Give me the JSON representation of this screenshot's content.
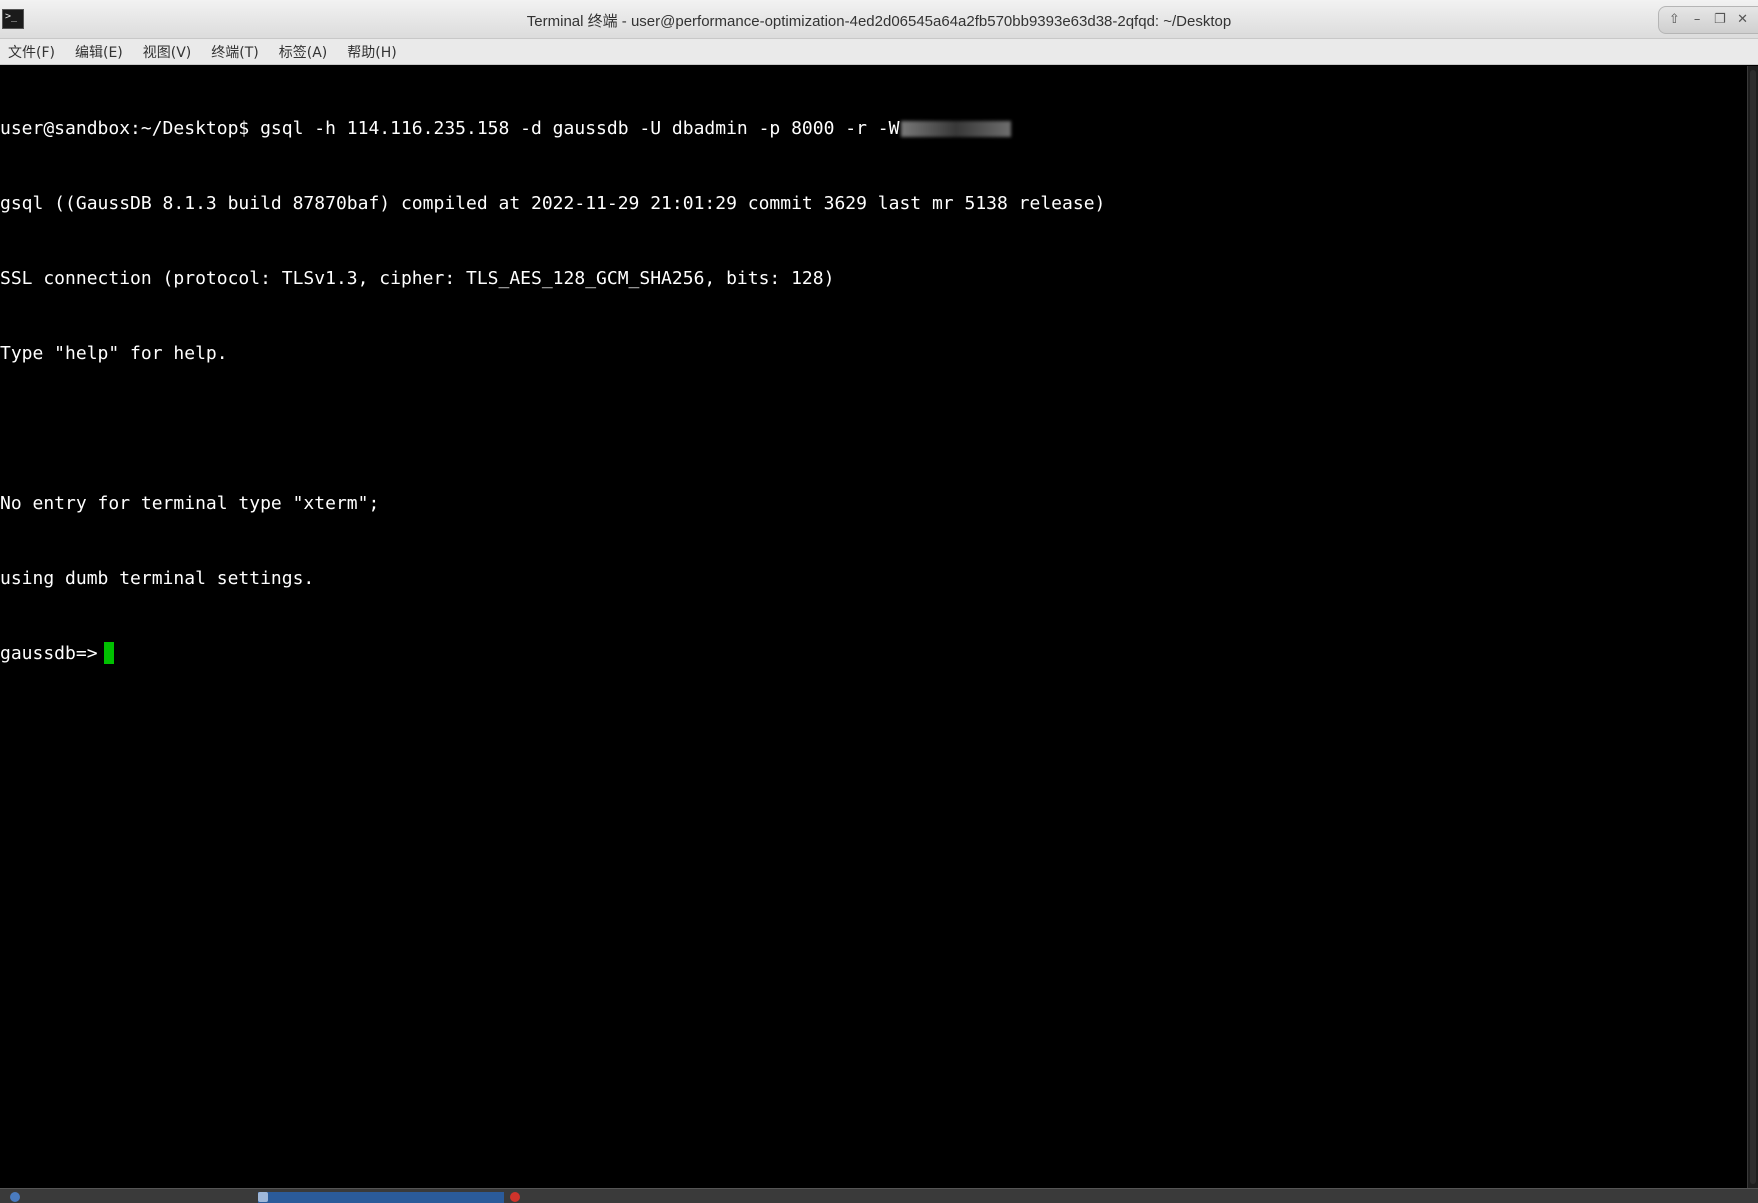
{
  "window": {
    "title": "Terminal 终端 - user@performance-optimization-4ed2d06545a64a2fb570bb9393e63d38-2qfqd: ~/Desktop",
    "app_icon_glyph": ">_",
    "controls": {
      "up_glyph": "⇧",
      "minimize_glyph": "–",
      "maximize_glyph": "❐",
      "close_glyph": "✕"
    }
  },
  "menubar": {
    "items": [
      {
        "label": "文件(F)"
      },
      {
        "label": "编辑(E)"
      },
      {
        "label": "视图(V)"
      },
      {
        "label": "终端(T)"
      },
      {
        "label": "标签(A)"
      },
      {
        "label": "帮助(H)"
      }
    ]
  },
  "terminal": {
    "colors": {
      "background": "#000000",
      "foreground": "#ffffff",
      "cursor": "#00c000"
    },
    "lines": [
      {
        "text": "user@sandbox:~/Desktop$ gsql -h 114.116.235.158 -d gaussdb -U dbadmin -p 8000 -r -W",
        "redacted_tail": true
      },
      {
        "text": "gsql ((GaussDB 8.1.3 build 87870baf) compiled at 2022-11-29 21:01:29 commit 3629 last mr 5138 release)"
      },
      {
        "text": "SSL connection (protocol: TLSv1.3, cipher: TLS_AES_128_GCM_SHA256, bits: 128)"
      },
      {
        "text": "Type \"help\" for help."
      },
      {
        "text": ""
      },
      {
        "text": "No entry for terminal type \"xterm\";"
      },
      {
        "text": "using dumb terminal settings."
      }
    ],
    "prompt": "gaussdb=>"
  },
  "taskbar": {
    "tasks": [
      {
        "label": "",
        "color": "#4a7bbf"
      },
      {
        "label": "",
        "color": "#2b5b9a",
        "active": true
      },
      {
        "label": "",
        "color": "#d0332b"
      }
    ]
  }
}
